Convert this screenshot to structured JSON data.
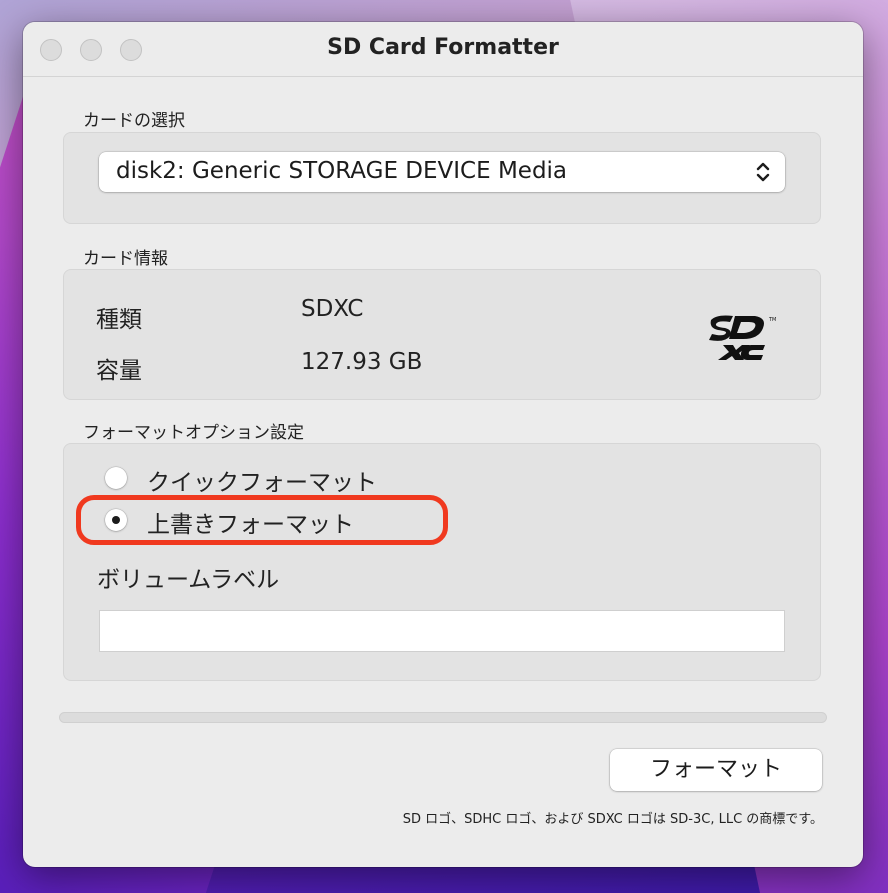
{
  "window": {
    "title": "SD Card Formatter"
  },
  "card_selection": {
    "label": "カードの選択",
    "selected": "disk2: Generic STORAGE DEVICE Media"
  },
  "card_info": {
    "label": "カード情報",
    "type_key": "種類",
    "type_value": "SDXC",
    "capacity_key": "容量",
    "capacity_value": "127.93 GB",
    "logo_icon": "sdxc-logo-icon"
  },
  "format_options": {
    "label": "フォーマットオプション設定",
    "options": [
      {
        "label": "クイックフォーマット",
        "selected": false
      },
      {
        "label": "上書きフォーマット",
        "selected": true
      }
    ],
    "volume_label": "ボリュームラベル",
    "volume_value": ""
  },
  "actions": {
    "format_button": "フォーマット"
  },
  "progress": {
    "fraction": 0
  },
  "footer": {
    "note": "SD ロゴ、SDHC ロゴ、および SDXC ロゴは SD-3C, LLC の商標です。"
  },
  "annotation": {
    "highlight_color": "#f0391f"
  }
}
